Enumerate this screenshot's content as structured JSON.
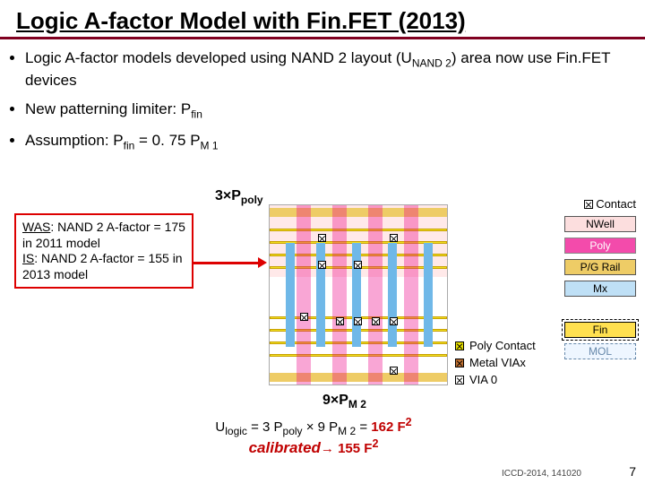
{
  "title": "Logic A-factor Model with Fin.FET (2013)",
  "bullets": {
    "b1_a": "Logic A-factor models developed using NAND 2 layout (U",
    "b1_sub": "NAND 2",
    "b1_b": ") area now use Fin.FET devices",
    "b2_a": "New patterning limiter: P",
    "b2_sub": "fin",
    "b3_a": "Assumption: P",
    "b3_sub1": "fin",
    "b3_mid": " = 0. 75 P",
    "b3_sub2": "M 1"
  },
  "labels": {
    "three_ppoly_a": "3×P",
    "three_ppoly_sub": "poly",
    "nine_pm2_a": "9×P",
    "nine_pm2_sub": "M 2"
  },
  "callout": {
    "was_label": "WAS",
    "was_text": ": NAND 2 A-factor = 175 in 2011 model",
    "is_label": "IS",
    "is_text": ": NAND 2 A-factor = 155 in 2013 model"
  },
  "legend": {
    "contact": "Contact",
    "nwell": "NWell",
    "poly": "Poly",
    "pgrail": "P/G Rail",
    "mx": "Mx",
    "fin": "Fin",
    "mol": "MOL",
    "poly_contact": "Poly Contact",
    "metal_viax": "Metal VIAx",
    "via0": "VIA 0"
  },
  "formula": {
    "line1_a": "U",
    "line1_sub1": "logic",
    "line1_b": " = 3 P",
    "line1_sub2": "poly",
    "line1_c": " × 9 P",
    "line1_sub3": "M 2",
    "line1_d": " = ",
    "line1_red": "162 F",
    "line1_sup": "2",
    "line2_cal": "calibrated",
    "line2_arrow": "→",
    "line2_red": "155 F",
    "line2_sup": "2"
  },
  "footer": "ICCD-2014, 141020",
  "page": "7"
}
